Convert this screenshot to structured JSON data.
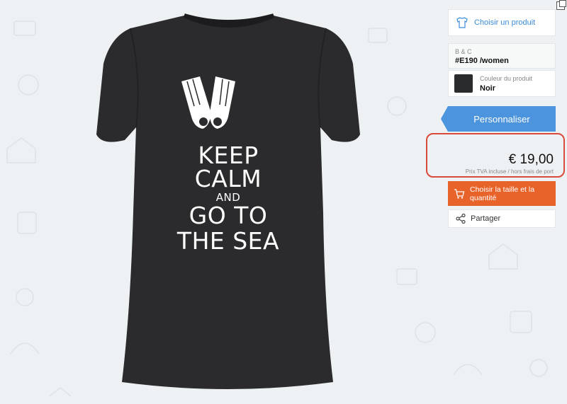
{
  "panel": {
    "choose_product": "Choisir un produit",
    "brand": "B & C",
    "model": "#E190 /women",
    "color_label": "Couleur du produit",
    "color_value": "Noir",
    "swatch_color": "#2a2b2d",
    "personalize": "Personnaliser",
    "price": "€ 19,00",
    "price_note": "Prix TVA incluse / hors frais de port",
    "size_button": "Choisir la taille et la quantité",
    "share": "Partager"
  },
  "design": {
    "line1": "KEEP",
    "line2": "CALM",
    "line3": "AND",
    "line4": "GO TO",
    "line5": "THE  SEA"
  },
  "colors": {
    "accent_blue": "#4c94dd",
    "accent_orange": "#e8632a",
    "highlight_red": "#d94a3a",
    "shirt": "#2b2b2d"
  },
  "icons": [
    "expand-icon",
    "tshirt-icon",
    "cart-icon",
    "share-icon",
    "flippers-icon"
  ]
}
